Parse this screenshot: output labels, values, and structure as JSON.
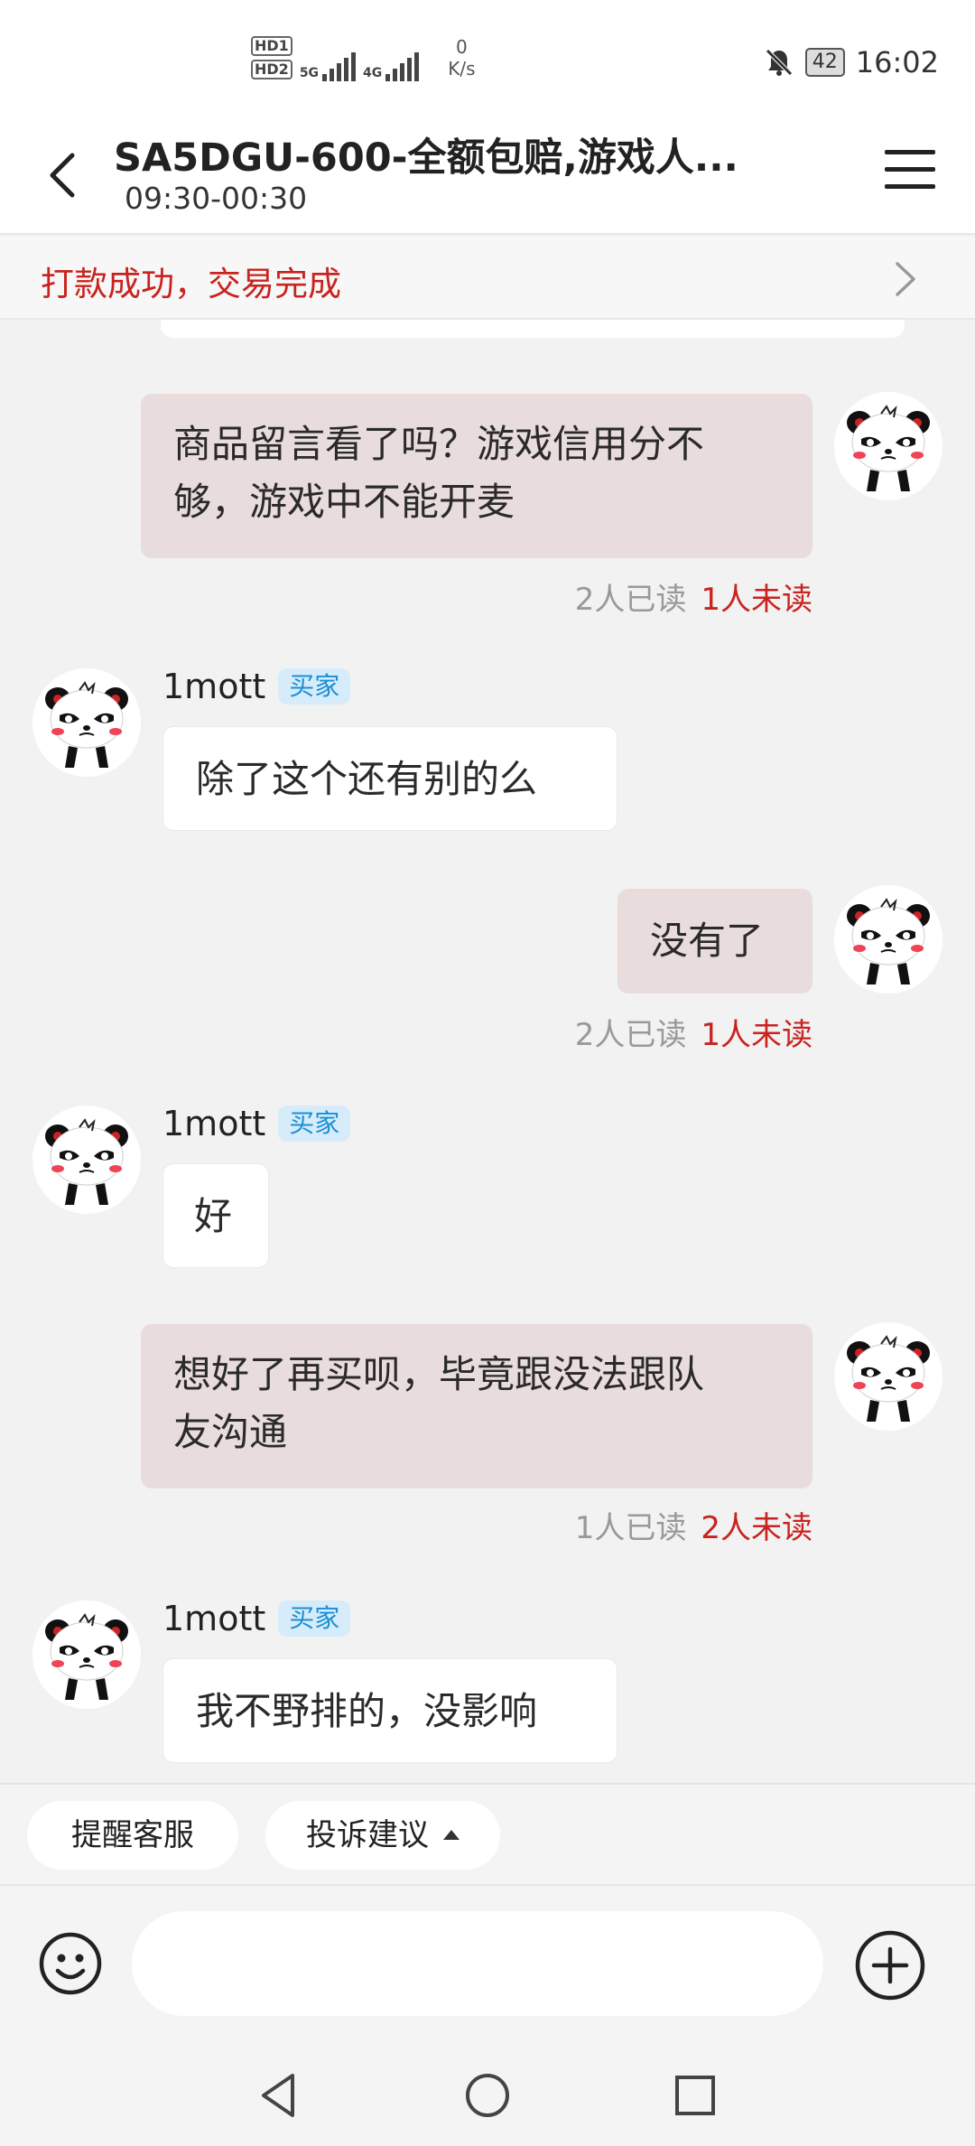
{
  "status_bar": {
    "sim1": "HD1",
    "sim2": "HD2",
    "network1": "5G",
    "network2": "4G",
    "speed_value": "0",
    "speed_unit": "K/s",
    "battery": "42",
    "time": "16:02"
  },
  "header": {
    "title": "SA5DGU-600-全额包赔,游戏人...",
    "subtitle": "09:30-00:30"
  },
  "banner": {
    "text": "打款成功，交易完成"
  },
  "messages": [
    {
      "side": "self",
      "lines": [
        "商品留言看了吗？游戏信用分不",
        "够，游戏中不能开麦"
      ],
      "read": "2人已读",
      "unread": "1人未读"
    },
    {
      "side": "other",
      "user": "1mott",
      "tag": "买家",
      "text": "除了这个还有别的么"
    },
    {
      "side": "self",
      "text": "没有了",
      "read": "2人已读",
      "unread": "1人未读"
    },
    {
      "side": "other",
      "user": "1mott",
      "tag": "买家",
      "text": "好"
    },
    {
      "side": "self",
      "lines": [
        "想好了再买呗，毕竟跟没法跟队",
        "友沟通"
      ],
      "read": "1人已读",
      "unread": "2人未读"
    },
    {
      "side": "other",
      "user": "1mott",
      "tag": "买家",
      "text": "我不野排的，没影响"
    }
  ],
  "actions": {
    "remind": "提醒客服",
    "complain": "投诉建议"
  },
  "input": {
    "placeholder": ""
  },
  "icons": {
    "back": "back-arrow-icon",
    "menu": "menu-icon",
    "emoji": "emoji-icon",
    "plus": "plus-icon",
    "avatar": "panda-avatar"
  },
  "colors": {
    "accent_red": "#c8231f",
    "self_bubble": "#e9dcdc",
    "tag_blue": "#1a8fd6"
  }
}
